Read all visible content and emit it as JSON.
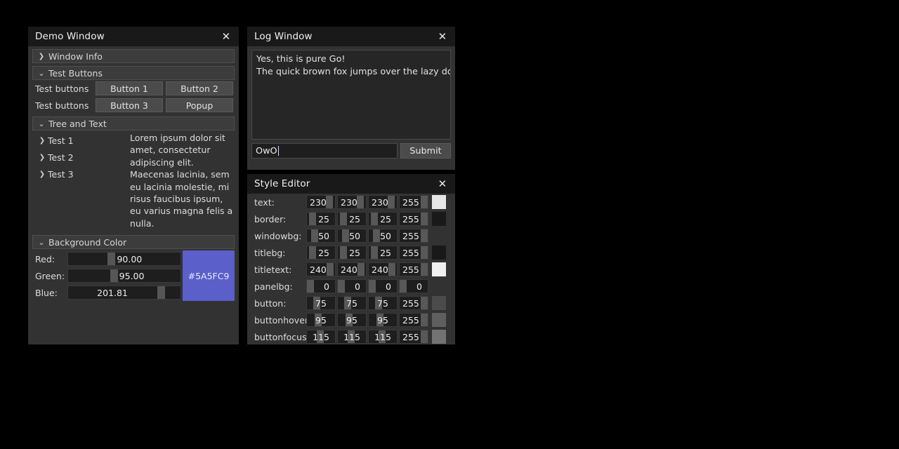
{
  "demo_window": {
    "title": "Demo Window",
    "close_icon": "close-icon",
    "groups": [
      {
        "label": "Window Info",
        "chevron": "chevron-right-icon",
        "expanded": false
      },
      {
        "label": "Test Buttons",
        "chevron": "chevron-down-icon",
        "expanded": true
      },
      {
        "label": "Tree and Text",
        "chevron": "chevron-down-icon",
        "expanded": true
      },
      {
        "label": "Background Color",
        "chevron": "chevron-down-icon",
        "expanded": true
      }
    ],
    "button_rows": [
      {
        "label": "Test buttons",
        "buttons": [
          "Button 1",
          "Button 2"
        ]
      },
      {
        "label": "Test buttons",
        "buttons": [
          "Button 3",
          "Popup"
        ]
      }
    ],
    "tree_nodes": [
      {
        "label": "Test 1",
        "chevron": "chevron-right-icon"
      },
      {
        "label": "Test 2",
        "chevron": "chevron-right-icon"
      },
      {
        "label": "Test 3",
        "chevron": "chevron-right-icon"
      }
    ],
    "paragraph": "Lorem ipsum dolor sit amet, consectetur adipiscing elit. Maecenas lacinia, sem eu lacinia molestie, mi risus faucibus ipsum, eu varius magna felis a nulla.",
    "background_color": {
      "channels": [
        {
          "label": "Red:",
          "value": "90.00",
          "percent": 35.3
        },
        {
          "label": "Green:",
          "value": "95.00",
          "percent": 37.3
        },
        {
          "label": "Blue:",
          "value": "201.81",
          "percent": 79.1
        }
      ],
      "hex_label": "#5A5FC9",
      "hex": "#5A5FC9"
    }
  },
  "log_window": {
    "title": "Log Window",
    "close_icon": "close-icon",
    "lines": [
      "Yes, this is pure Go!",
      "The quick brown fox jumps over the lazy dog"
    ],
    "input_value": "OwO",
    "submit_label": "Submit"
  },
  "style_editor": {
    "title": "Style Editor",
    "close_icon": "close-icon",
    "rows": [
      {
        "label": "text:",
        "values": [
          "230",
          "230",
          "230",
          "255"
        ],
        "percents": [
          90.2,
          90.2,
          90.2,
          100
        ],
        "swatch": "#E6E6E6",
        "has_swatch": true
      },
      {
        "label": "border:",
        "values": [
          "25",
          "25",
          "25",
          "255"
        ],
        "percents": [
          9.8,
          9.8,
          9.8,
          100
        ],
        "swatch": "#191919",
        "has_swatch": true
      },
      {
        "label": "windowbg:",
        "values": [
          "50",
          "50",
          "50",
          "255"
        ],
        "percents": [
          19.6,
          19.6,
          19.6,
          100
        ],
        "swatch": "#323232",
        "has_swatch": true
      },
      {
        "label": "titlebg:",
        "values": [
          "25",
          "25",
          "25",
          "255"
        ],
        "percents": [
          9.8,
          9.8,
          9.8,
          100
        ],
        "swatch": "#191919",
        "has_swatch": true
      },
      {
        "label": "titletext:",
        "values": [
          "240",
          "240",
          "240",
          "255"
        ],
        "percents": [
          94.1,
          94.1,
          94.1,
          100
        ],
        "swatch": "#F0F0F0",
        "has_swatch": true
      },
      {
        "label": "panelbg:",
        "values": [
          "0",
          "0",
          "0",
          "0"
        ],
        "percents": [
          0,
          0,
          0,
          0
        ],
        "swatch": "transparent",
        "has_swatch": false
      },
      {
        "label": "button:",
        "values": [
          "75",
          "75",
          "75",
          "255"
        ],
        "percents": [
          29.4,
          29.4,
          29.4,
          100
        ],
        "swatch": "#4B4B4B",
        "has_swatch": true
      },
      {
        "label": "buttonhover",
        "values": [
          "95",
          "95",
          "95",
          "255"
        ],
        "percents": [
          37.3,
          37.3,
          37.3,
          100
        ],
        "swatch": "#5F5F5F",
        "has_swatch": true
      },
      {
        "label": "buttonfocus:",
        "values": [
          "115",
          "115",
          "115",
          "255"
        ],
        "percents": [
          45.1,
          45.1,
          45.1,
          100
        ],
        "swatch": "#737373",
        "has_swatch": true
      }
    ]
  },
  "theme": {
    "desktop_bg": "#000000",
    "window_bg": "#323232",
    "title_bg": "#191919",
    "title_text": "#F0F0F0",
    "text": "#E6E6E6",
    "button": "#4B4B4B",
    "border": "#4A4A4A"
  }
}
